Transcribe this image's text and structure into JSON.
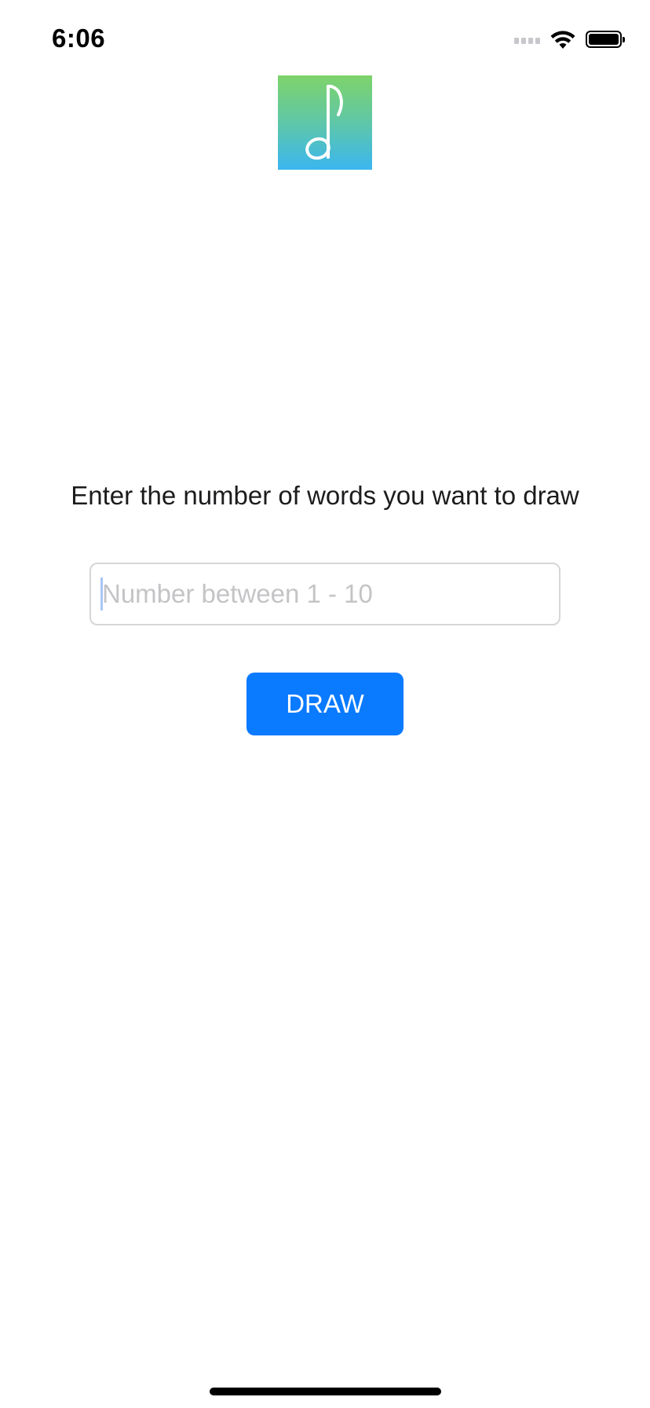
{
  "status_bar": {
    "time": "6:06",
    "signal_icon": "cellular-signal-icon",
    "wifi_icon": "wifi-icon",
    "battery_icon": "battery-icon"
  },
  "logo": {
    "icon": "music-note-icon",
    "gradient_top": "#7ed36a",
    "gradient_bottom": "#3bb6f0"
  },
  "prompt": {
    "text": "Enter the number of words you want to draw"
  },
  "input": {
    "placeholder": "Number between 1 - 10",
    "value": ""
  },
  "draw_button": {
    "label": "DRAW",
    "color": "#0a7aff"
  }
}
